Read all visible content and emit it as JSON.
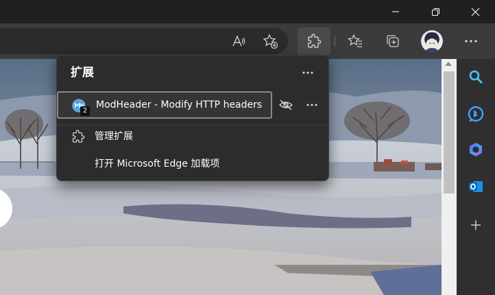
{
  "titlebar": {
    "controls": [
      "minimize",
      "restore",
      "close"
    ]
  },
  "toolbar": {
    "icons": [
      "read-aloud-icon",
      "add-favorite-icon",
      "extensions-icon",
      "favorites-icon",
      "collections-icon",
      "profile-avatar",
      "settings-more-icon"
    ]
  },
  "flyout": {
    "title": "扩展",
    "extension": {
      "name": "ModHeader - Modify HTTP headers",
      "badge": "2"
    },
    "manage_label": "管理扩展",
    "open_addons_label": "打开 Microsoft Edge 加载项"
  },
  "sidebar": {
    "icons": [
      "search-icon",
      "bing-chat-icon",
      "copilot-icon",
      "outlook-icon",
      "add-icon"
    ]
  },
  "colors": {
    "accent_blue": "#4cc2ff",
    "flyout_bg": "#2c2c2c",
    "toolbar_bg": "#3b3b3b"
  }
}
